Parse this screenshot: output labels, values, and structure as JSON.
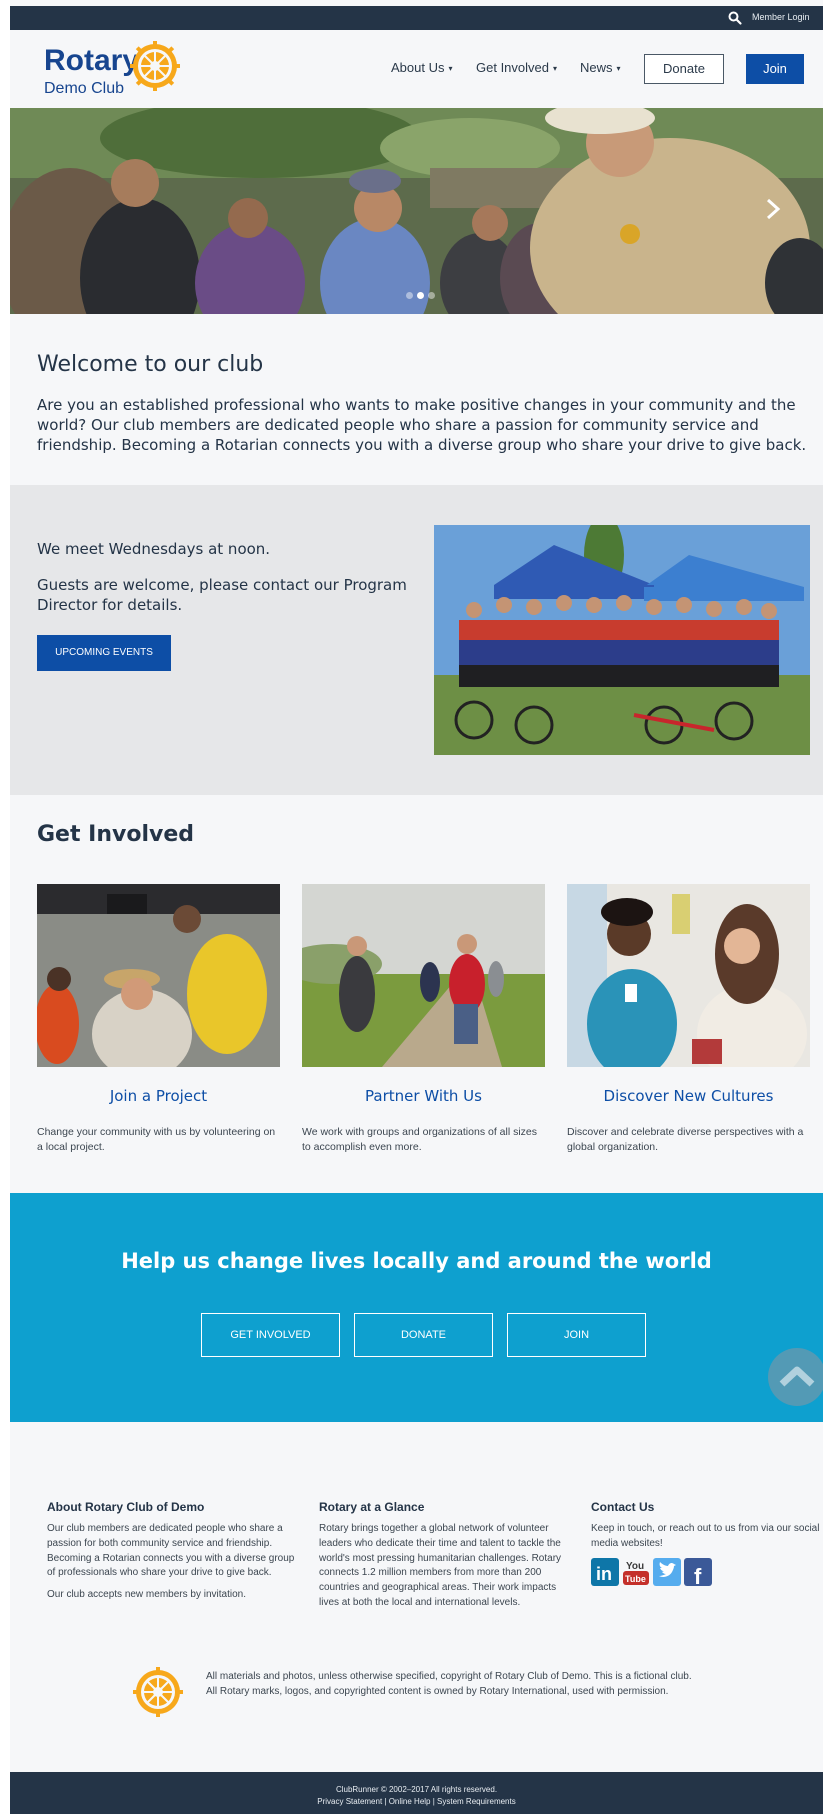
{
  "topbar": {
    "login_label": "Member Login",
    "search_icon": "search-icon"
  },
  "header": {
    "logo_word": "Rotary",
    "logo_sub": "Demo Club",
    "nav": [
      {
        "label": "About Us",
        "caret": "▾"
      },
      {
        "label": "Get Involved",
        "caret": "▾"
      },
      {
        "label": "News",
        "caret": "▾"
      }
    ],
    "donate_label": "Donate",
    "join_label": "Join"
  },
  "hero": {
    "slide_count": 3,
    "active_slide": 2
  },
  "welcome": {
    "title": "Welcome to our club",
    "text": "Are you an established professional who wants to make positive changes in your community and the world? Our club members are dedicated people who share a passion for community service and friendship. Becoming a Rotarian connects you with a diverse group who share your drive to give back."
  },
  "meet": {
    "line1": "We meet Wednesdays at noon.",
    "line2": "Guests are welcome, please contact our Program Director for details.",
    "button": "UPCOMING EVENTS"
  },
  "get_involved": {
    "title": "Get Involved",
    "cards": [
      {
        "title": "Join a Project",
        "text": "Change your community with us by volunteering on a local project."
      },
      {
        "title": "Partner With Us",
        "text": "We work with groups and organizations of all sizes to accomplish even more."
      },
      {
        "title": "Discover New Cultures",
        "text": "Discover and celebrate diverse perspectives with a global organization."
      }
    ]
  },
  "cta": {
    "title": "Help us change lives locally and around the world",
    "buttons": [
      "GET INVOLVED",
      "DONATE",
      "JOIN"
    ]
  },
  "footer": {
    "about": {
      "title": "About Rotary Club of Demo",
      "p1": "Our club members are dedicated people who share a passion for both community service and friendship. Becoming a Rotarian connects you with a diverse group of professionals who share your drive to give back.",
      "p2": "Our club accepts new members by invitation."
    },
    "glance": {
      "title": "Rotary at a Glance",
      "p1": "Rotary brings together a global network of volunteer leaders who dedicate their time and talent to tackle the world's most pressing humanitarian challenges. Rotary connects 1.2 million members from more than 200 countries and geographical areas. Their work impacts lives at both the local and international levels."
    },
    "contact": {
      "title": "Contact Us",
      "p1": "Keep in touch, or reach out to us from via our social media websites!",
      "social": [
        "linkedin-icon",
        "youtube-icon",
        "twitter-icon",
        "facebook-icon"
      ],
      "youtube_you": "You",
      "youtube_tube": "Tube",
      "linkedin_glyph": "in",
      "facebook_glyph": "f"
    },
    "copyright_1": "All materials and photos, unless otherwise specified, copyright of Rotary Club of Demo. This is a fictional club.",
    "copyright_2": "All Rotary marks, logos, and copyrighted content is owned by Rotary International, used with permission."
  },
  "bottombar": {
    "line1": "ClubRunner © 2002–2017  All rights reserved.",
    "line2": "Privacy Statement | Online Help | System Requirements"
  },
  "colors": {
    "navy": "#243447",
    "rotary_blue": "#17458f",
    "button_blue": "#0d4ea6",
    "cta_cyan": "#0ea0cf",
    "gold": "#f7a81b"
  }
}
